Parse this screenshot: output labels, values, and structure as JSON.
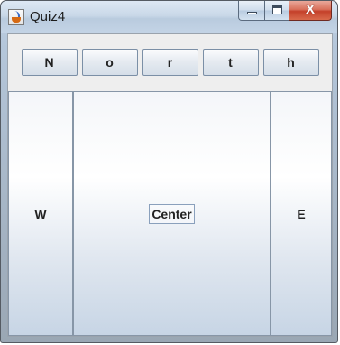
{
  "window": {
    "title": "Quiz4",
    "app_icon": "java-coffee-cup-icon",
    "controls": {
      "minimize": "minimize-icon",
      "maximize": "maximize-icon",
      "close_glyph": "X"
    }
  },
  "north": {
    "buttons": [
      {
        "label": "N"
      },
      {
        "label": "o"
      },
      {
        "label": "r"
      },
      {
        "label": "t"
      },
      {
        "label": "h"
      }
    ]
  },
  "west": {
    "label": "W"
  },
  "center": {
    "label": "Center"
  },
  "east": {
    "label": "E"
  },
  "colors": {
    "region_top": "#ffffff",
    "region_bottom": "#c7d5e5",
    "border": "#8796a7",
    "close_button": "#c4402a"
  }
}
